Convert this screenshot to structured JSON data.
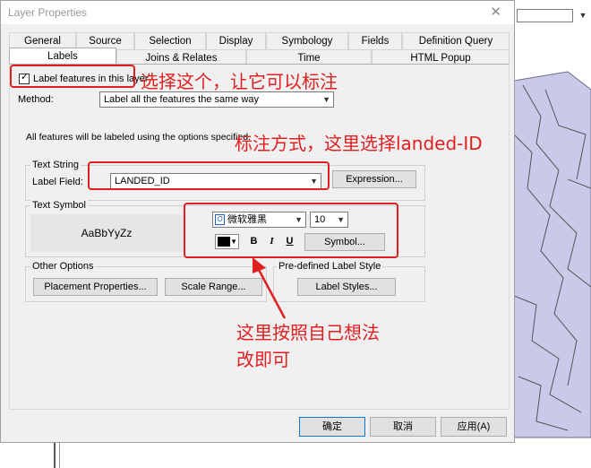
{
  "window": {
    "title": "Layer Properties"
  },
  "tabs_row1": [
    "General",
    "Source",
    "Selection",
    "Display",
    "Symbology",
    "Fields",
    "Definition Query"
  ],
  "tabs_row2": [
    "Labels",
    "Joins & Relates",
    "Time",
    "HTML Popup"
  ],
  "active_tab": "Labels",
  "label_features": {
    "label": "Label features in this layer",
    "checked": true,
    "mark": "✓"
  },
  "method": {
    "label": "Method:",
    "value": "Label all the features the same way"
  },
  "description": "All features will be labeled using the options specified.",
  "text_string": {
    "group_title": "Text String",
    "field_label": "Label Field:",
    "field_value": "LANDED_ID",
    "expression_button": "Expression..."
  },
  "text_symbol": {
    "group_title": "Text Symbol",
    "preview": "AaBbYyZz",
    "font_icon": "O",
    "font_name": "微软雅黑",
    "font_size": "10",
    "bold": "B",
    "italic": "I",
    "underline": "U",
    "symbol_button": "Symbol...",
    "color": "#000000"
  },
  "other_options": {
    "group_title": "Other Options",
    "placement_button": "Placement Properties...",
    "scale_button": "Scale Range..."
  },
  "predefined": {
    "group_title": "Pre-defined Label Style",
    "styles_button": "Label Styles..."
  },
  "footer": {
    "ok": "确定",
    "cancel": "取消",
    "apply": "应用(A)"
  },
  "annotations": {
    "select_this": "选择这个，让它可以标注",
    "method_note": "标注方式，这里选择landed-ID",
    "custom_note_line1": "这里按照自己想法",
    "custom_note_line2": "改即可",
    "color": "#e02020"
  },
  "icons": {
    "close": "close-icon",
    "dropdown": "chevron-down-icon",
    "check": "checkmark-icon",
    "font": "font-type-icon"
  }
}
